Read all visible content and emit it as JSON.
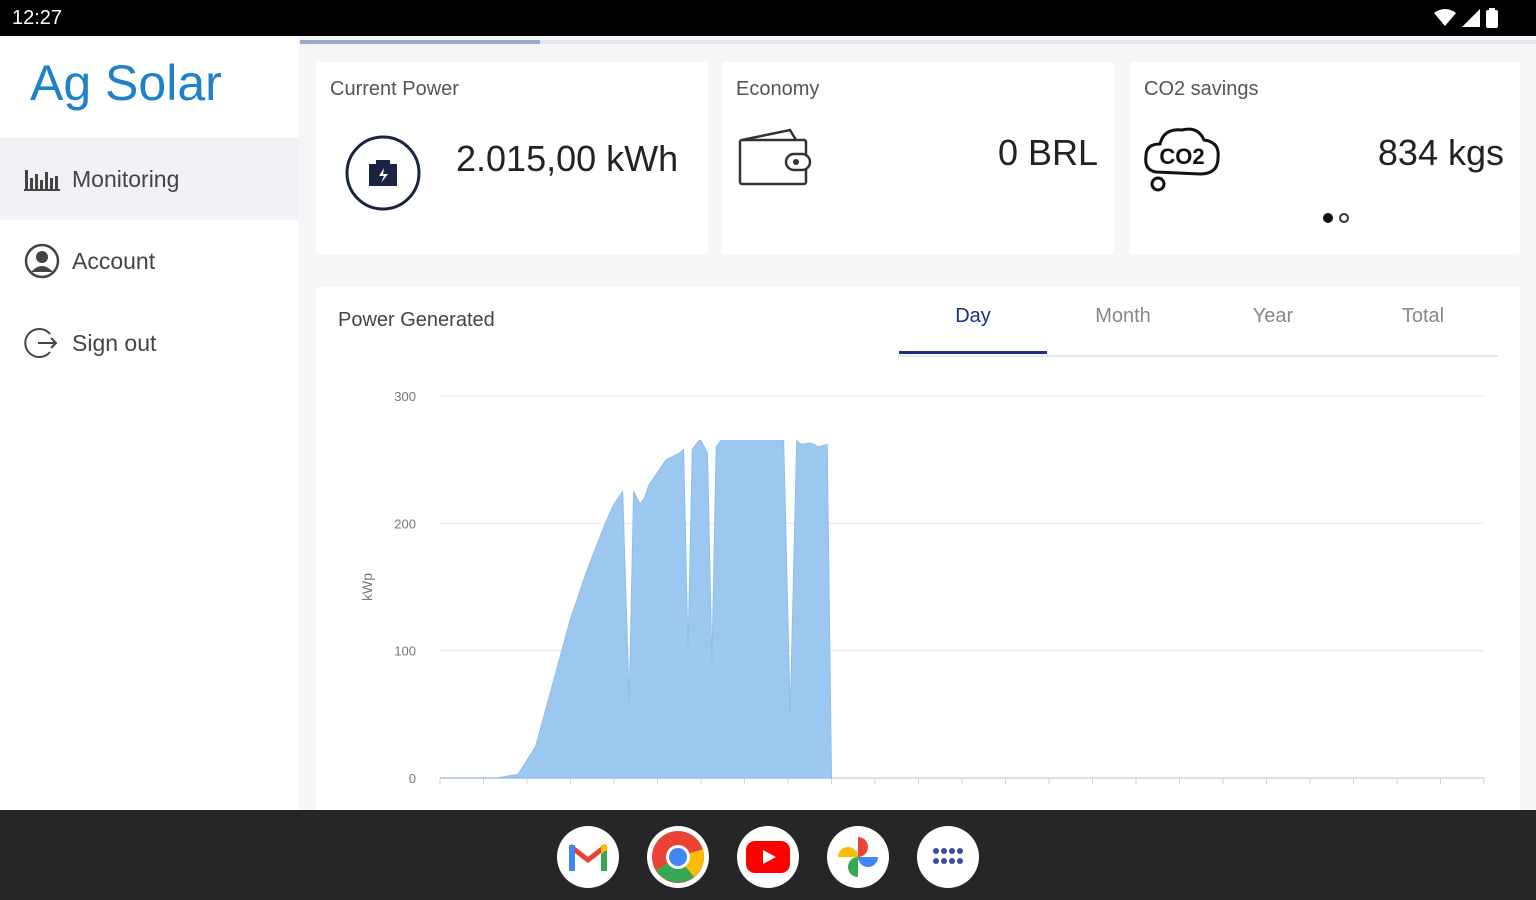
{
  "status_bar": {
    "time": "12:27"
  },
  "sidebar": {
    "brand": "Ag Solar",
    "items": [
      {
        "label": "Monitoring",
        "icon": "bar-chart-icon",
        "active": true
      },
      {
        "label": "Account",
        "icon": "account-circle-icon",
        "active": false
      },
      {
        "label": "Sign out",
        "icon": "sign-out-icon",
        "active": false
      }
    ]
  },
  "cards": {
    "current_power": {
      "title": "Current Power",
      "value": "2.015,00 kWh",
      "icon": "solar-meter-icon"
    },
    "economy": {
      "title": "Economy",
      "value": "0 BRL",
      "icon": "wallet-icon"
    },
    "co2": {
      "title": "CO2 savings",
      "value": "834 kgs",
      "icon": "co2-cloud-icon",
      "icon_text": "CO2"
    }
  },
  "pager": {
    "pages": 2,
    "active": 0
  },
  "power_chart": {
    "title": "Power Generated",
    "tabs": [
      "Day",
      "Month",
      "Year",
      "Total"
    ],
    "active_tab": "Day"
  },
  "chart_data": {
    "type": "area",
    "ylabel": "kWp",
    "ylim": [
      0,
      300
    ],
    "yticks": [
      0,
      100,
      200,
      300
    ],
    "color": "#9cc8ef",
    "x_count": 25,
    "x_index": [
      0,
      1.3,
      1.8,
      2.2,
      2.6,
      3.0,
      3.4,
      3.8,
      4.0,
      4.2,
      4.35,
      4.45,
      4.6,
      4.7,
      4.8,
      5.0,
      5.2,
      5.5,
      5.6,
      5.7,
      5.8,
      5.95,
      6.0,
      6.15,
      6.25,
      6.35,
      6.45,
      6.6,
      7.0,
      7.5,
      7.9,
      8.05,
      8.2,
      8.3,
      8.5,
      8.6,
      8.7,
      8.9,
      9.0
    ],
    "values": [
      0,
      0,
      3,
      25,
      75,
      125,
      165,
      200,
      215,
      225,
      60,
      225,
      215,
      220,
      230,
      240,
      250,
      255,
      258,
      100,
      258,
      265,
      265,
      255,
      90,
      260,
      265,
      265,
      265,
      265,
      265,
      50,
      265,
      262,
      263,
      262,
      260,
      262,
      0
    ]
  },
  "nav_bar": {
    "apps": [
      "gmail-icon",
      "chrome-icon",
      "youtube-icon",
      "photos-icon",
      "app-drawer-icon"
    ]
  }
}
